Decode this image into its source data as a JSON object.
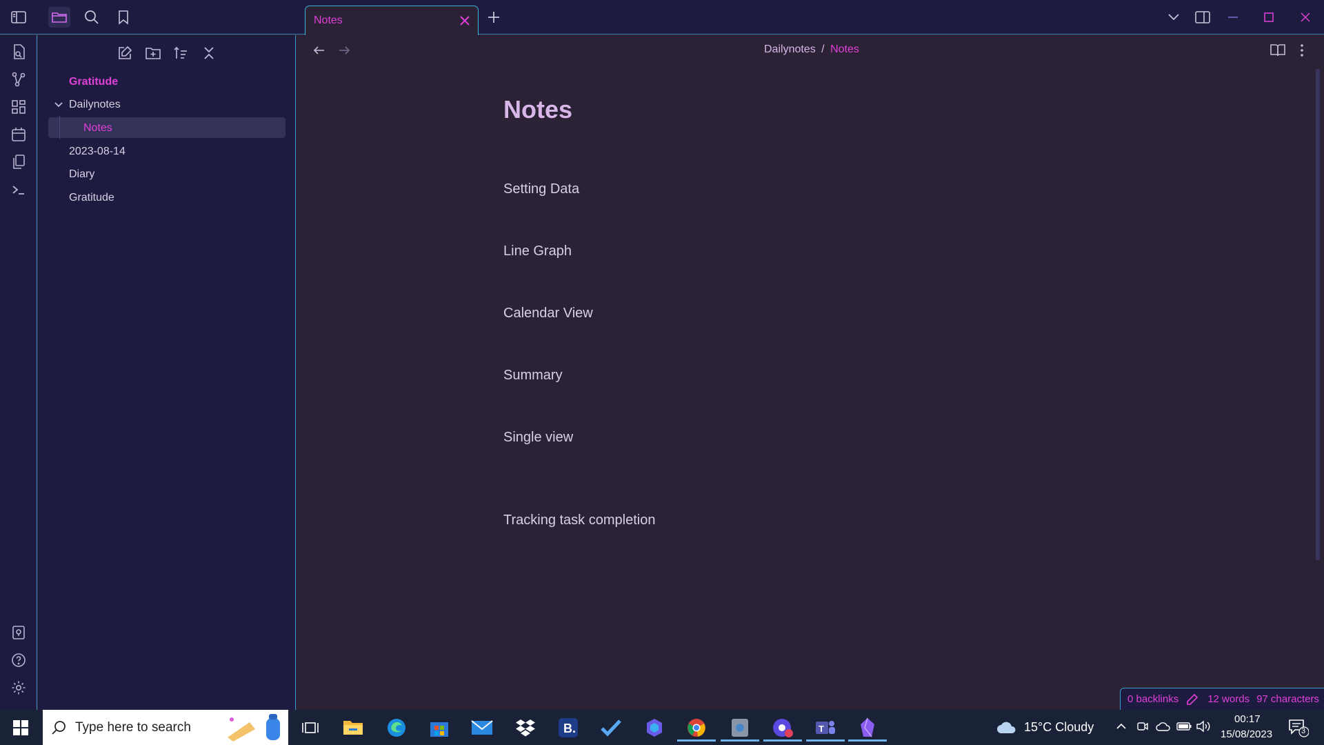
{
  "window": {
    "tab_title": "Notes",
    "colors": {
      "accent": "#e040d8",
      "bg": "#2b2236",
      "panel": "#1e1b40",
      "border": "#3a9cc8"
    }
  },
  "titlebar_icons": [
    "sidebar-toggle-icon",
    "folder-icon",
    "search-icon",
    "bookmark-icon"
  ],
  "ribbon_icons": [
    "quick-switcher-icon",
    "graph-view-icon",
    "canvas-icon",
    "calendar-icon",
    "templates-icon",
    "command-palette-icon",
    "vault-icon",
    "help-icon",
    "settings-icon"
  ],
  "explorer": {
    "tree": {
      "top_gratitude": "Gratitude",
      "dailynotes": "Dailynotes",
      "notes": "Notes",
      "date_note": "2023-08-14",
      "diary": "Diary",
      "gratitude": "Gratitude"
    }
  },
  "editor": {
    "breadcrumb": {
      "folder": "Dailynotes",
      "separator": "/",
      "file": "Notes"
    },
    "title": "Notes",
    "headings": [
      "Setting Data",
      "Line Graph",
      "Calendar View",
      "Summary",
      "Single view",
      "Tracking task completion"
    ]
  },
  "statusbar": {
    "backlinks": "0 backlinks",
    "words": "12 words",
    "characters": "97 characters"
  },
  "taskbar": {
    "search_placeholder": "Type here to search",
    "weather": "15°C  Cloudy",
    "time": "00:17",
    "date": "15/08/2023",
    "notification_count": "3"
  }
}
